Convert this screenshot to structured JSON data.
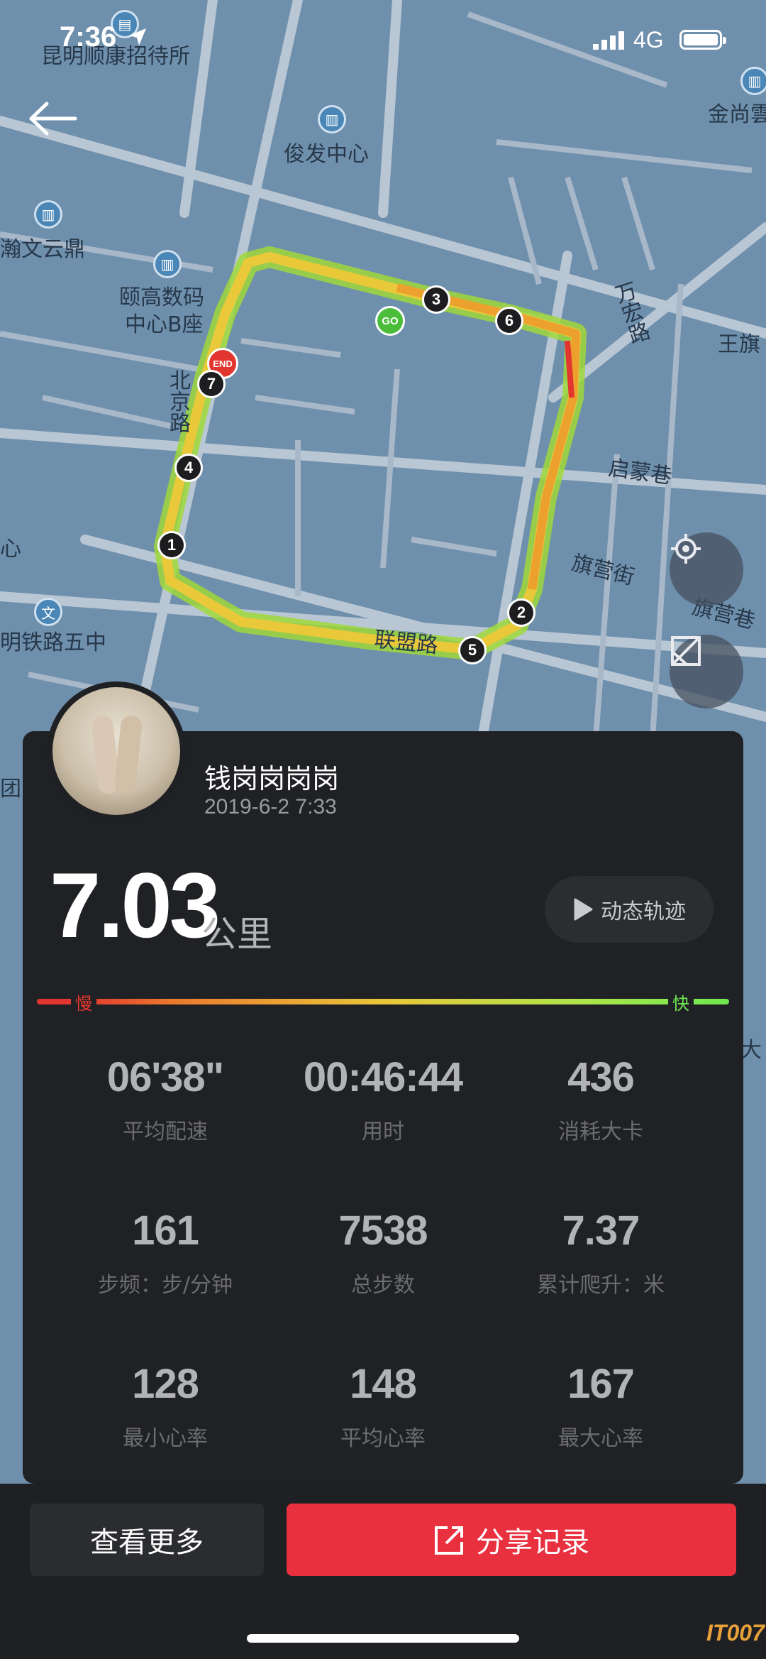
{
  "status_bar": {
    "time": "7:36",
    "network": "4G"
  },
  "map": {
    "labels": [
      "昆明顺康招待所",
      "俊发中心",
      "金尚雲",
      "瀚文云鼎",
      "颐高数码",
      "中心B座",
      "北京路",
      "万宏路",
      "王旗",
      "启蒙巷",
      "旗营街",
      "旗营巷",
      "明铁路五中",
      "联盟路",
      "心",
      "团",
      "大"
    ],
    "markers": {
      "go": "GO",
      "end": "END",
      "laps": [
        "1",
        "2",
        "3",
        "4",
        "5",
        "6",
        "7"
      ]
    }
  },
  "profile": {
    "name": "钱岗岗岗岗",
    "datetime": "2019-6-2 7:33"
  },
  "summary": {
    "distance": "7.03",
    "unit": "公里",
    "replay_label": "动态轨迹"
  },
  "pace_bar": {
    "slow_label": "慢",
    "fast_label": "快"
  },
  "stats": [
    {
      "value": "06'38\"",
      "label": "平均配速"
    },
    {
      "value": "00:46:44",
      "label": "用时"
    },
    {
      "value": "436",
      "label": "消耗大卡"
    },
    {
      "value": "161",
      "label": "步频：步/分钟"
    },
    {
      "value": "7538",
      "label": "总步数"
    },
    {
      "value": "7.37",
      "label": "累计爬升：米"
    },
    {
      "value": "128",
      "label": "最小心率"
    },
    {
      "value": "148",
      "label": "平均心率"
    },
    {
      "value": "167",
      "label": "最大心率"
    }
  ],
  "actions": {
    "more_label": "查看更多",
    "share_label": "分享记录"
  },
  "watermark": "IT007"
}
